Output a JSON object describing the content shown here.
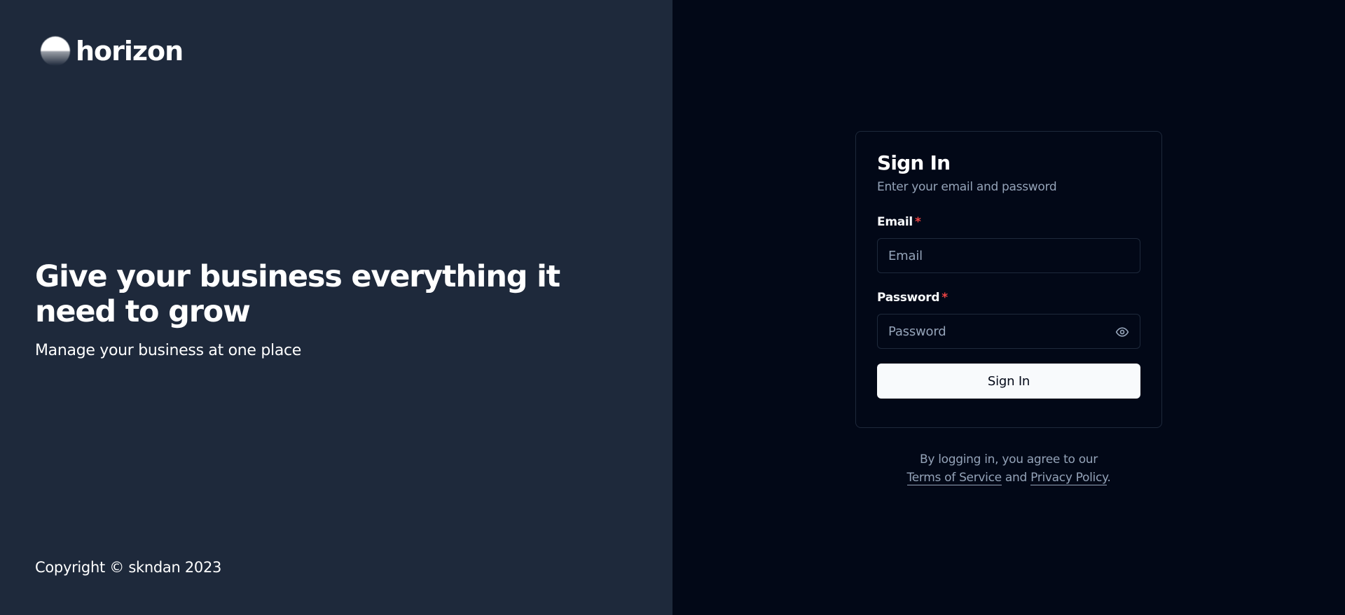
{
  "brand": {
    "name": "horizon"
  },
  "hero": {
    "headline": "Give your business everything it need to grow",
    "tagline": "Manage your business at one place"
  },
  "footer": {
    "copyright": "Copyright © skndan 2023"
  },
  "signin": {
    "title": "Sign In",
    "subtitle": "Enter your email and password",
    "email_label": "Email",
    "email_placeholder": "Email",
    "password_label": "Password",
    "password_placeholder": "Password",
    "required_mark": "*",
    "submit_label": "Sign In",
    "password_toggle_icon": "eye-icon"
  },
  "legal": {
    "prefix": "By logging in, you agree to our",
    "terms": "Terms of Service",
    "conjunction": "and",
    "privacy": "Privacy Policy",
    "suffix": "."
  },
  "colors": {
    "left_bg": "#1e293b",
    "right_bg": "#020817",
    "button_bg": "#f8fafc",
    "required": "#ef4444",
    "muted_text": "#94a3b8"
  }
}
